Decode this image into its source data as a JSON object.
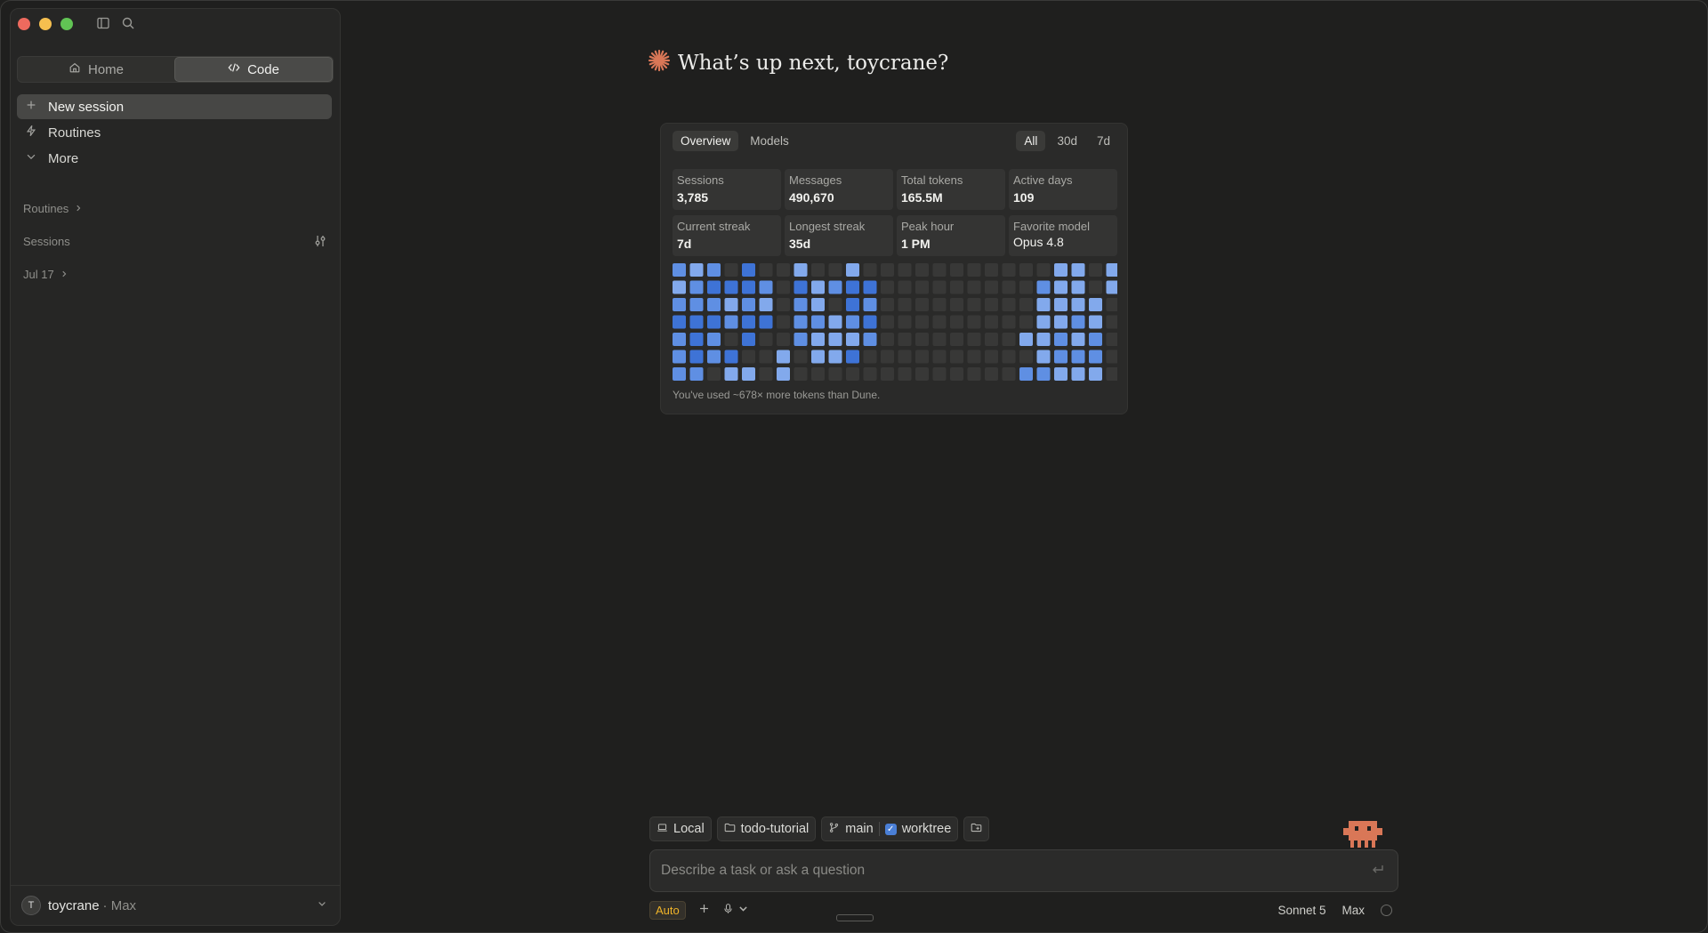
{
  "sidebar": {
    "segments": [
      {
        "label": "Home",
        "icon": "home-icon",
        "active": false
      },
      {
        "label": "Code",
        "icon": "code-icon",
        "active": true
      }
    ],
    "nav": [
      {
        "label": "New session",
        "icon": "plus-icon",
        "active": true
      },
      {
        "label": "Routines",
        "icon": "bolt-icon",
        "active": false
      },
      {
        "label": "More",
        "icon": "chevron-down-icon",
        "active": false
      }
    ],
    "sections": {
      "routines": "Routines",
      "sessions": "Sessions",
      "date_group": "Jul 17"
    },
    "user": {
      "initial": "T",
      "name": "toycrane",
      "plan": "· Max"
    }
  },
  "main": {
    "greeting": "What’s up next, toycrane?",
    "stats_card": {
      "tabs": [
        "Overview",
        "Models"
      ],
      "active_tab": "Overview",
      "ranges": [
        "All",
        "30d",
        "7d"
      ],
      "active_range": "All",
      "stats": [
        {
          "label": "Sessions",
          "value": "3,785"
        },
        {
          "label": "Messages",
          "value": "490,670"
        },
        {
          "label": "Total tokens",
          "value": "165.5M"
        },
        {
          "label": "Active days",
          "value": "109"
        },
        {
          "label": "Current streak",
          "value": "7d"
        },
        {
          "label": "Longest streak",
          "value": "35d"
        },
        {
          "label": "Peak hour",
          "value": "1 PM"
        },
        {
          "label": "Favorite model",
          "value": "Opus 4.8"
        }
      ],
      "heatmap_levels": [
        [
          2,
          1,
          2,
          0,
          3,
          0,
          0,
          1,
          0,
          0,
          1,
          0,
          0,
          0,
          0,
          0,
          0,
          0,
          0,
          0,
          0,
          0,
          1,
          1,
          0,
          1
        ],
        [
          1,
          2,
          3,
          3,
          3,
          2,
          0,
          3,
          1,
          2,
          3,
          3,
          0,
          0,
          0,
          0,
          0,
          0,
          0,
          0,
          0,
          2,
          1,
          1,
          0,
          1
        ],
        [
          2,
          2,
          2,
          1,
          2,
          1,
          0,
          2,
          1,
          0,
          3,
          2,
          0,
          0,
          0,
          0,
          0,
          0,
          0,
          0,
          0,
          1,
          1,
          1,
          1,
          0
        ],
        [
          3,
          3,
          3,
          2,
          3,
          3,
          0,
          2,
          2,
          1,
          2,
          3,
          0,
          0,
          0,
          0,
          0,
          0,
          0,
          0,
          0,
          1,
          1,
          2,
          1,
          0
        ],
        [
          2,
          3,
          2,
          0,
          3,
          0,
          0,
          2,
          1,
          1,
          1,
          2,
          0,
          0,
          0,
          0,
          0,
          0,
          0,
          0,
          1,
          1,
          2,
          1,
          2,
          0
        ],
        [
          2,
          3,
          2,
          3,
          0,
          0,
          1,
          0,
          1,
          1,
          3,
          0,
          0,
          0,
          0,
          0,
          0,
          0,
          0,
          0,
          0,
          1,
          2,
          2,
          2,
          0
        ],
        [
          2,
          2,
          0,
          1,
          1,
          0,
          1,
          0,
          0,
          0,
          0,
          0,
          0,
          0,
          0,
          0,
          0,
          0,
          0,
          0,
          2,
          2,
          1,
          1,
          1,
          0
        ]
      ],
      "heat_colors": [
        "#383837",
        "#82a9ec",
        "#5f8fe3",
        "#3e73d6"
      ],
      "footnote": "You've used ~678× more tokens than Dune."
    }
  },
  "composer": {
    "chips": {
      "location": "Local",
      "folder": "todo-tutorial",
      "branch": "main",
      "worktree": "worktree"
    },
    "placeholder": "Describe a task or ask a question",
    "mode": "Auto",
    "model": "Sonnet 5",
    "effort": "Max"
  },
  "colors": {
    "accent": "#d97757",
    "mode_badge": "#f0b429",
    "checkbox": "#4a7fd6"
  }
}
